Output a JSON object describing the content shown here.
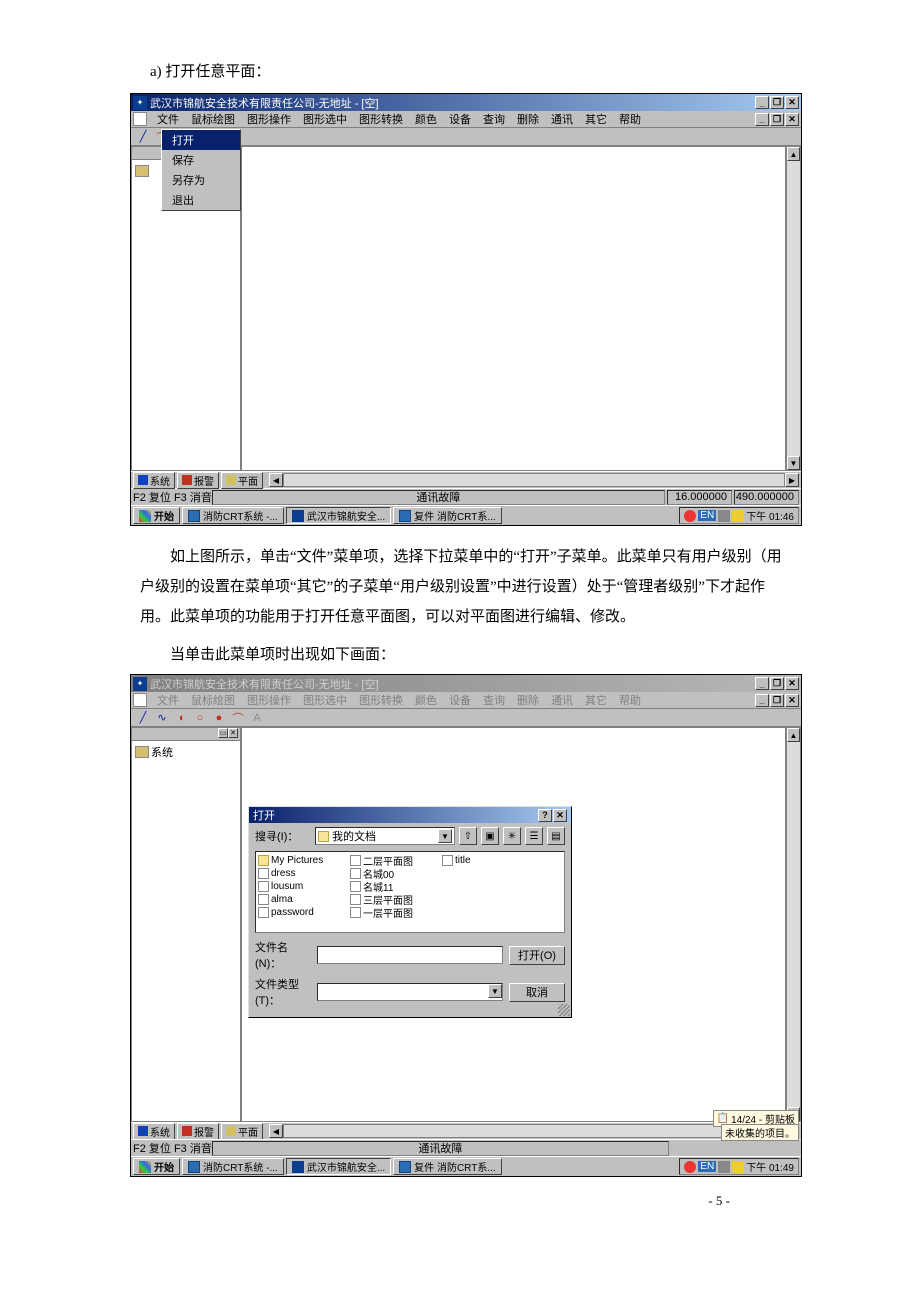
{
  "doc": {
    "section_label": "a)   打开任意平面：",
    "para1": "如上图所示，单击“文件”菜单项，选择下拉菜单中的“打开”子菜单。此菜单只有用户级别（用户级别的设置在菜单项“其它”的子菜单“用户级别设置”中进行设置）处于“管理者级别”下才起作用。此菜单项的功能用于打开任意平面图，可以对平面图进行编辑、修改。",
    "para2": "当单击此菜单项时出现如下画面：",
    "page_num": "- 5 -"
  },
  "app": {
    "title": "武汉市锦航安全技术有限责任公司-无地址 - [空]"
  },
  "menus": [
    "文件",
    "鼠标绘图",
    "图形操作",
    "图形选中",
    "图形转换",
    "颜色",
    "设备",
    "查询",
    "删除",
    "通讯",
    "其它",
    "帮助"
  ],
  "file_menu": {
    "open": "打开",
    "save": "保存",
    "saveas": "另存为",
    "exit": "退出"
  },
  "sidebar": {
    "system": "系统"
  },
  "bottom_tabs": {
    "system": "系统",
    "alarm": "报警",
    "plane": "平面"
  },
  "status": {
    "left": "F2 复位 F3 消音",
    "mid": "通讯故障",
    "num1": "16.000000",
    "num2": "490.000000"
  },
  "taskbar": {
    "start": "开始",
    "task1": "消防CRT系统 -...",
    "task2": "武汉市锦航安全...",
    "task3": "复件 消防CRT系...",
    "lang": "EN",
    "time1": "下午 01:46",
    "time2": "下午 01:49",
    "clipboard": "14/24 - 剪贴板",
    "clipnote": "未收集的项目。"
  },
  "open_dialog": {
    "title": "打开",
    "look_in_label": "搜寻(I)：",
    "look_in_value": "我的文档",
    "files_left": [
      {
        "name": "My Pictures",
        "type": "folder"
      },
      {
        "name": "dress",
        "type": "file"
      },
      {
        "name": "lousum",
        "type": "file"
      },
      {
        "name": "alma",
        "type": "file"
      },
      {
        "name": "password",
        "type": "file"
      },
      {
        "name": "二层平面图",
        "type": "file"
      }
    ],
    "files_right": [
      {
        "name": "名城00",
        "type": "file"
      },
      {
        "name": "名城11",
        "type": "file"
      },
      {
        "name": "三层平面图",
        "type": "file"
      },
      {
        "name": "一层平面图",
        "type": "file"
      },
      {
        "name": "title",
        "type": "file"
      }
    ],
    "filename_label": "文件名(N)：",
    "filetype_label": "文件类型(T)：",
    "open_btn": "打开(O)",
    "cancel_btn": "取消"
  }
}
